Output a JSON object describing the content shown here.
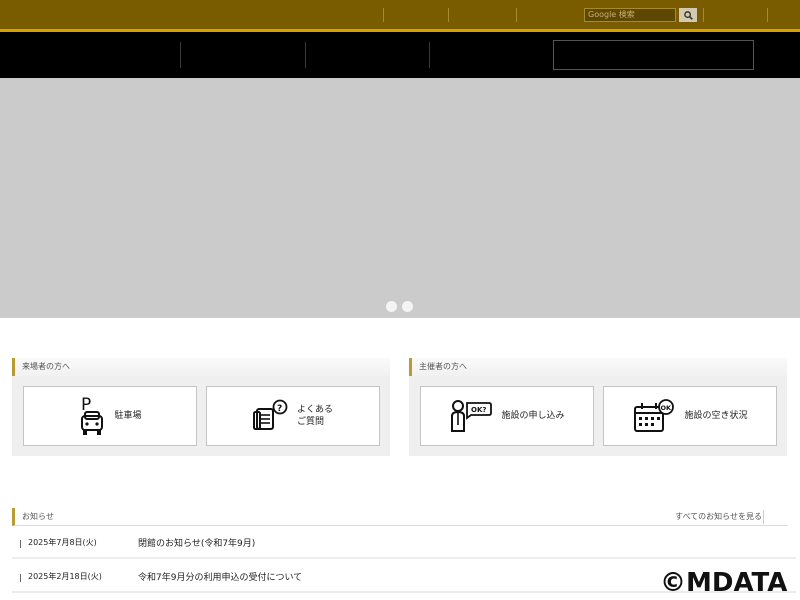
{
  "header": {
    "search_placeholder": "Google 検索"
  },
  "panels": [
    {
      "title": "来場者の方へ",
      "cards": [
        {
          "label": "駐車場",
          "icon": "parking-car-icon"
        },
        {
          "label": "よくある\nご質問",
          "icon": "faq-document-icon"
        }
      ]
    },
    {
      "title": "主催者の方へ",
      "cards": [
        {
          "label": "施設の申し込み",
          "icon": "person-ok-icon"
        },
        {
          "label": "施設の空き状況",
          "icon": "calendar-ok-icon"
        }
      ]
    }
  ],
  "news": {
    "title": "お知らせ",
    "all_link": "すべてのお知らせを見る",
    "items": [
      {
        "date": "2025年7月8日(火)",
        "text": "閉館のお知らせ(令和7年9月)"
      },
      {
        "date": "2025年2月18日(火)",
        "text": "令和7年9月分の利用申込の受付について"
      }
    ]
  },
  "watermark": "©MDATA",
  "colors": {
    "topbar": "#7a5c00",
    "accent": "#d7a200",
    "nav": "#000000",
    "hero": "#cbcbcb"
  }
}
